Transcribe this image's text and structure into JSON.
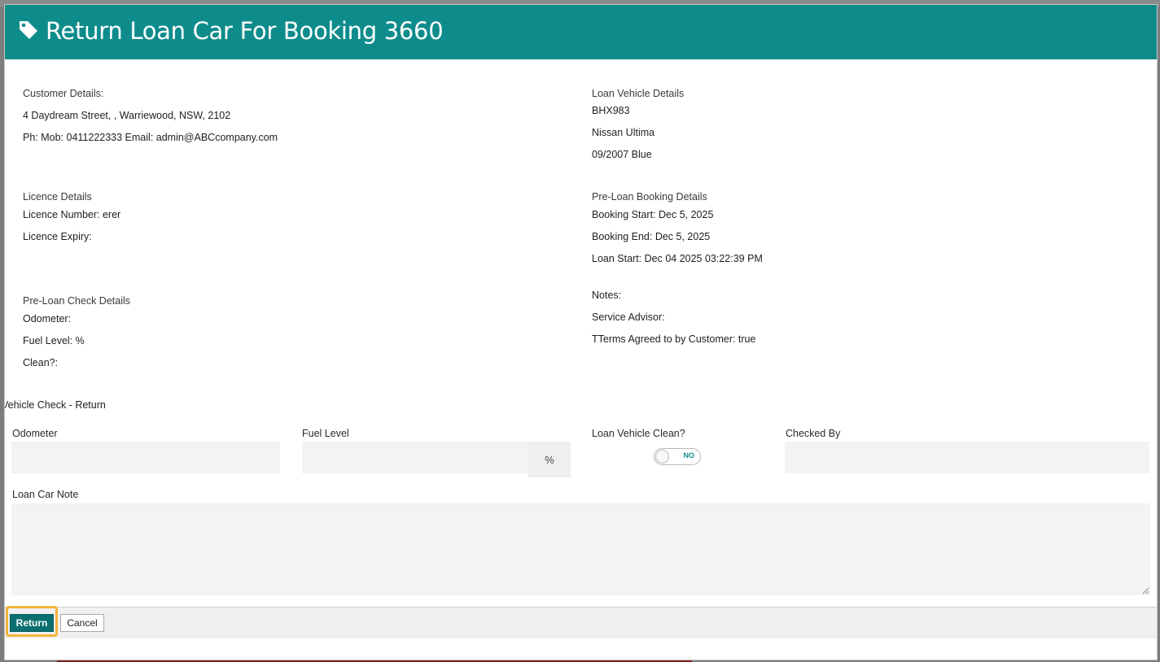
{
  "dialog": {
    "title": "Return Loan Car For Booking 3660",
    "icon": "tag-icon",
    "header_color": "#0e8c8c"
  },
  "customer": {
    "heading": "Customer Details:",
    "address": "4 Daydream Street, , Warriewood, NSW, 2102",
    "contact": "Ph: Mob: 0411222333 Email: admin@ABCcompany.com"
  },
  "loan_vehicle": {
    "heading": "Loan Vehicle Details",
    "rego": "BHX983",
    "model": "Nissan Ultima",
    "year_colour": "09/2007 Blue"
  },
  "licence": {
    "heading": "Licence Details",
    "number": "Licence Number: erer",
    "expiry": "Licence Expiry:"
  },
  "booking": {
    "heading": "Pre-Loan Booking Details",
    "start": "Booking Start: Dec 5, 2025",
    "end": "Booking End: Dec 5, 2025",
    "loan_start": "Loan Start: Dec 04 2025 03:22:39 PM"
  },
  "pre_check": {
    "heading": "Pre-Loan Check Details",
    "odometer": "Odometer:",
    "fuel": "Fuel Level: %",
    "clean": "Clean?:"
  },
  "notes": {
    "notes": "Notes:",
    "advisor": "Service Advisor:",
    "terms": "TTerms Agreed to by Customer: true"
  },
  "return_check": {
    "heading": "Vehicle Check - Return",
    "odometer_label": "Odometer",
    "fuel_label": "Fuel Level",
    "fuel_unit": "%",
    "clean_label": "Loan Vehicle Clean?",
    "clean_state": "NO",
    "checked_by_label": "Checked By",
    "note_label": "Loan Car Note"
  },
  "footer": {
    "return_label": "Return",
    "cancel_label": "Cancel"
  }
}
